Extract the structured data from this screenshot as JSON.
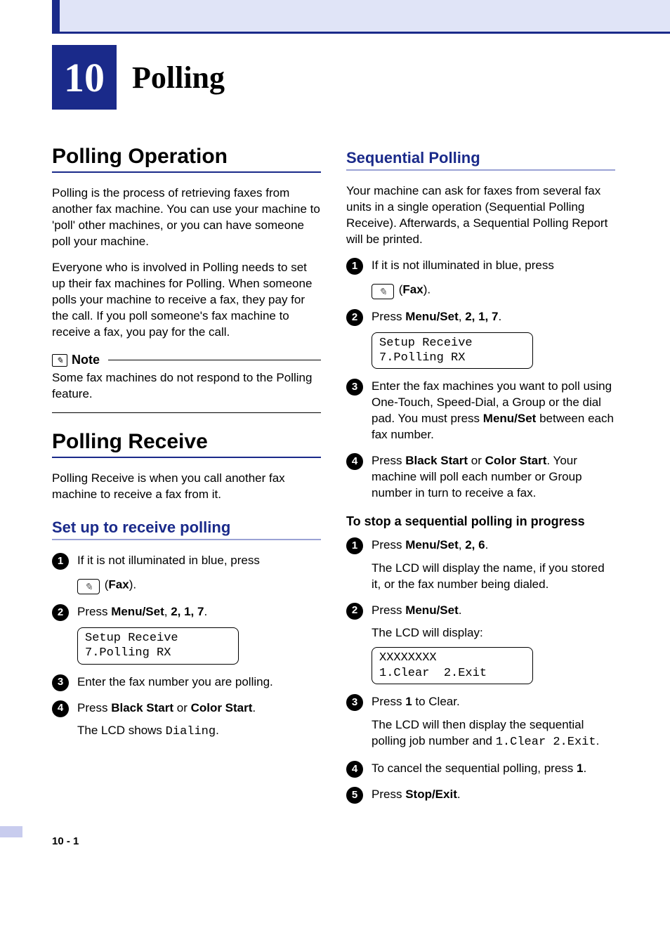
{
  "chapter": {
    "number": "10",
    "title": "Polling"
  },
  "page_number": "10 - 1",
  "left": {
    "sec1_title": "Polling Operation",
    "p1": "Polling is the process of retrieving faxes from another fax machine. You can use your machine to 'poll' other machines, or you can have someone poll your machine.",
    "p2": "Everyone who is involved in Polling needs to set up their fax machines for Polling. When someone polls your machine to receive a fax, they pay for the call. If you poll someone's fax machine to receive a fax, you pay for the call.",
    "note_title": "Note",
    "note_body": "Some fax machines do not respond to the Polling feature.",
    "sec2_title": "Polling Receive",
    "sec2_intro": "Polling Receive is when you call another fax machine to receive a fax from it.",
    "sub1_title": "Set up to receive polling",
    "steps1": {
      "s1a": "If it is not illuminated in blue, press",
      "s1b_label": "Fax",
      "s2_prefix": "Press ",
      "s2_bold": "Menu/Set",
      "s2_suffix": ", ",
      "s2_seq": "2, 1, 7",
      "s2_end": ".",
      "lcd1_line1": "Setup Receive",
      "lcd1_line2": "7.Polling RX",
      "s3": "Enter the fax number you are polling.",
      "s4_prefix": "Press ",
      "s4_b1": "Black Start",
      "s4_mid": " or ",
      "s4_b2": "Color Start",
      "s4_end": ".",
      "s4_sub_a": "The LCD shows ",
      "s4_sub_mono": "Dialing",
      "s4_sub_b": "."
    }
  },
  "right": {
    "sub2_title": "Sequential Polling",
    "intro": "Your machine can ask for faxes from several fax units in a single operation (Sequential Polling Receive). Afterwards, a Sequential Polling Report will be printed.",
    "steps2": {
      "s1a": "If it is not illuminated in blue, press",
      "s1b_label": "Fax",
      "s2_prefix": "Press ",
      "s2_bold": "Menu/Set",
      "s2_suffix": ", ",
      "s2_seq": "2, 1, 7",
      "s2_end": ".",
      "lcd_line1": "Setup Receive",
      "lcd_line2": "7.Polling RX",
      "s3a": "Enter the fax machines you want to poll using One-Touch, Speed-Dial, a Group or the dial pad. You must press ",
      "s3b_bold": "Menu/Set",
      "s3c": " between each fax number.",
      "s4_prefix": "Press ",
      "s4_b1": "Black Start",
      "s4_mid": " or ",
      "s4_b2": "Color Start",
      "s4_end": ". Your machine will poll each number or Group number in turn to receive a fax."
    },
    "stop_title": "To stop a sequential polling in progress",
    "steps3": {
      "s1_prefix": "Press ",
      "s1_bold": "Menu/Set",
      "s1_suffix": ", ",
      "s1_seq": "2, 6",
      "s1_end": ".",
      "s1_sub": "The LCD will display the name, if you stored it, or the fax number being dialed.",
      "s2_prefix": "Press ",
      "s2_bold": "Menu/Set",
      "s2_end": ".",
      "s2_sub": "The LCD will display:",
      "lcd2_line1": "XXXXXXXX",
      "lcd2_line2": "1.Clear  2.Exit",
      "s3_prefix": "Press ",
      "s3_bold": "1",
      "s3_end": " to Clear.",
      "s3_sub_a": "The LCD will then display the sequential polling job number and ",
      "s3_sub_mono": "1.Clear 2.Exit",
      "s3_sub_b": ".",
      "s4_a": "To cancel the sequential polling, press ",
      "s4_bold": "1",
      "s4_b": ".",
      "s5_prefix": "Press ",
      "s5_bold": "Stop/Exit",
      "s5_end": "."
    }
  }
}
